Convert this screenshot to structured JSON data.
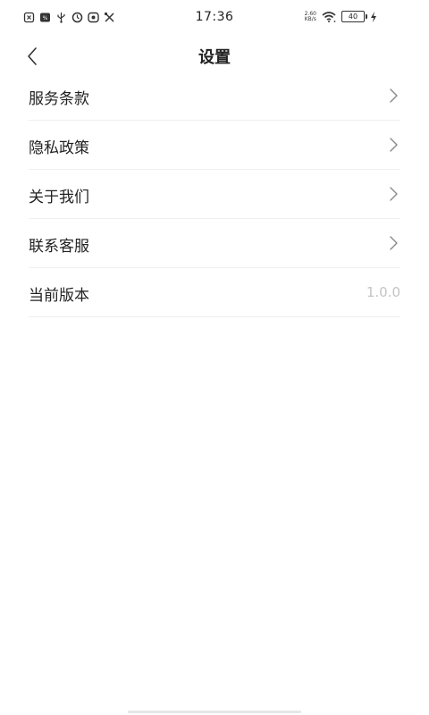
{
  "status_bar": {
    "time": "17:36",
    "net_speed_value": "2.60",
    "net_speed_unit": "KB/s",
    "battery": "40",
    "left_icons": [
      "sim-icon",
      "notification-icon",
      "usb-icon",
      "clock-icon",
      "message-icon",
      "tools-icon"
    ]
  },
  "header": {
    "title": "设置"
  },
  "settings": {
    "items": [
      {
        "label": "服务条款",
        "type": "link"
      },
      {
        "label": "隐私政策",
        "type": "link"
      },
      {
        "label": "关于我们",
        "type": "link"
      },
      {
        "label": "联系客服",
        "type": "link"
      },
      {
        "label": "当前版本",
        "type": "value",
        "value": "1.0.0"
      }
    ]
  }
}
